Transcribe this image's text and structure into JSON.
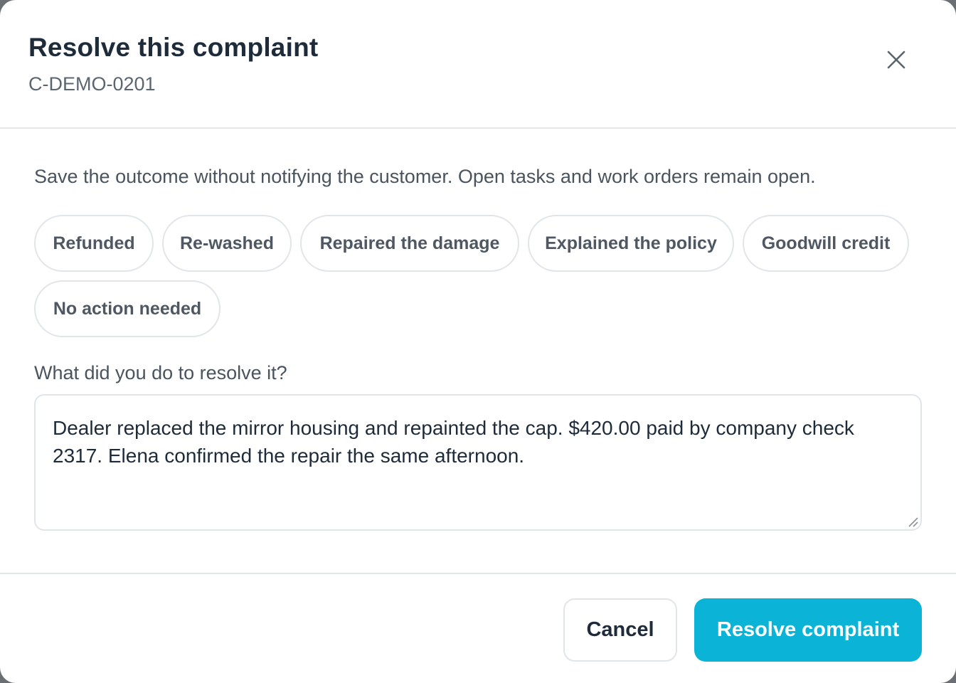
{
  "dialog": {
    "title": "Resolve this complaint",
    "subtitle": "C-DEMO-0201",
    "close_icon": "close-icon"
  },
  "body": {
    "description": "Save the outcome without notifying the customer. Open tasks and work orders remain open.",
    "outcomes": [
      {
        "label": "Refunded"
      },
      {
        "label": "Re-washed"
      },
      {
        "label": "Repaired the damage"
      },
      {
        "label": "Explained the policy"
      },
      {
        "label": "Goodwill credit"
      },
      {
        "label": "No action needed"
      }
    ],
    "resolution_label": "What did you do to resolve it?",
    "resolution_value": "Dealer replaced the mirror housing and repainted the cap. $420.00 paid by company check 2317. Elena confirmed the repair the same afternoon."
  },
  "footer": {
    "cancel_label": "Cancel",
    "resolve_label": "Resolve complaint"
  },
  "colors": {
    "accent": "#0bb4d6",
    "title": "#1d2b3a",
    "muted": "#5c6670",
    "border": "#e1e5e9"
  }
}
